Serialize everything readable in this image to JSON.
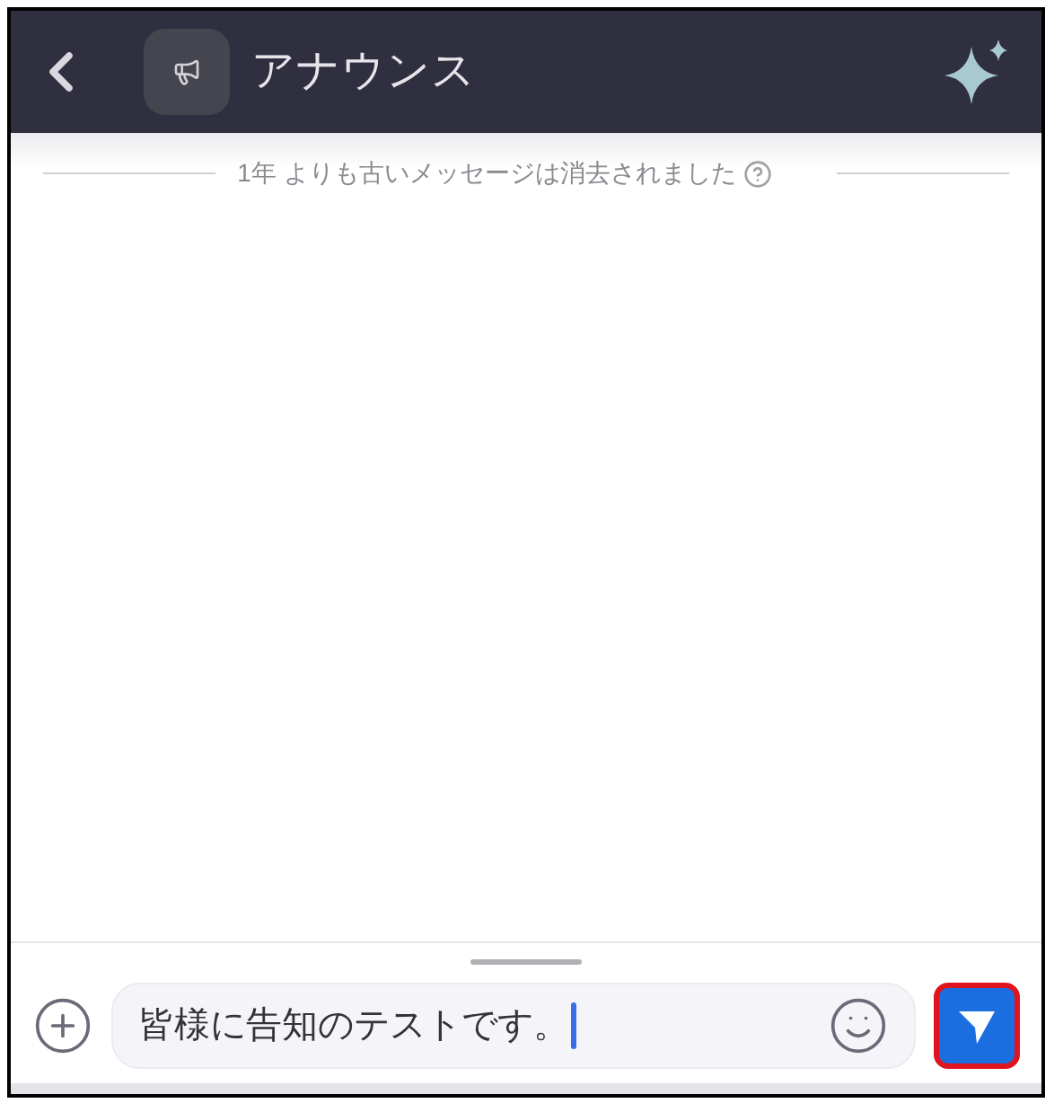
{
  "header": {
    "title": "アナウンス"
  },
  "notice": {
    "text": "1年 よりも古いメッセージは消去されました"
  },
  "composer": {
    "value": "皆様に告知のテストです。",
    "send_button": {
      "highlighted": true
    }
  }
}
